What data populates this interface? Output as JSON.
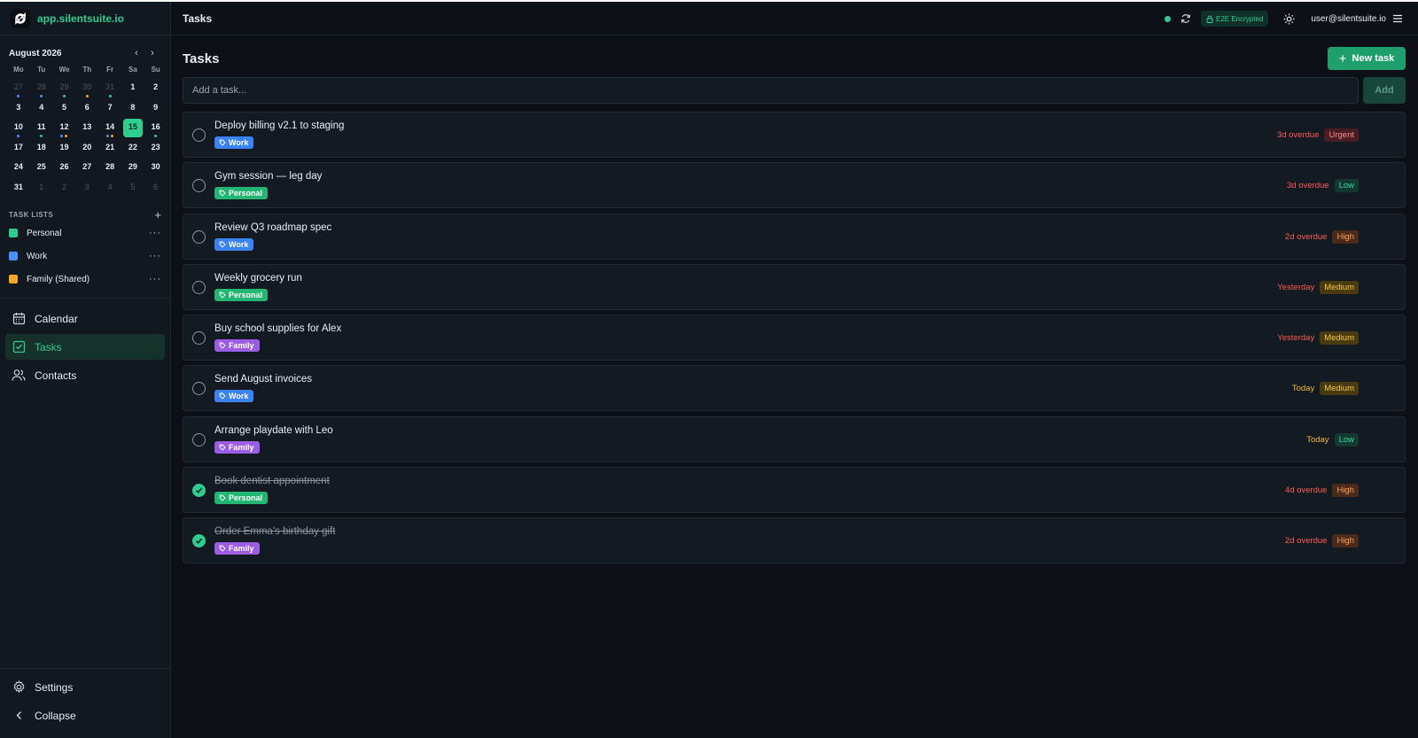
{
  "brand": {
    "name": "app.silentsuite.io"
  },
  "calendar": {
    "title": "August 2026",
    "weekdays": [
      "Mo",
      "Tu",
      "We",
      "Th",
      "Fr",
      "Sa",
      "Su"
    ],
    "days": [
      {
        "d": "27",
        "muted": true,
        "dots": [
          "#4c8dff"
        ]
      },
      {
        "d": "28",
        "muted": true,
        "dots": [
          "#4c8dff"
        ]
      },
      {
        "d": "29",
        "muted": true,
        "dots": [
          "#2ecc8f"
        ]
      },
      {
        "d": "30",
        "muted": true,
        "dots": [
          "#f5a623"
        ]
      },
      {
        "d": "31",
        "muted": true,
        "dots": [
          "#2ecc8f"
        ]
      },
      {
        "d": "1"
      },
      {
        "d": "2"
      },
      {
        "d": "3"
      },
      {
        "d": "4"
      },
      {
        "d": "5"
      },
      {
        "d": "6"
      },
      {
        "d": "7"
      },
      {
        "d": "8"
      },
      {
        "d": "9"
      },
      {
        "d": "10",
        "dots": [
          "#4c8dff"
        ]
      },
      {
        "d": "11",
        "dots": [
          "#2ecc8f"
        ]
      },
      {
        "d": "12",
        "dots": [
          "#4c8dff",
          "#f5a623"
        ]
      },
      {
        "d": "13"
      },
      {
        "d": "14",
        "dots": [
          "#4c8dff",
          "#f5a623"
        ]
      },
      {
        "d": "15",
        "today": true
      },
      {
        "d": "16",
        "dots": [
          "#2ecc8f"
        ]
      },
      {
        "d": "17"
      },
      {
        "d": "18"
      },
      {
        "d": "19"
      },
      {
        "d": "20"
      },
      {
        "d": "21"
      },
      {
        "d": "22"
      },
      {
        "d": "23"
      },
      {
        "d": "24"
      },
      {
        "d": "25"
      },
      {
        "d": "26"
      },
      {
        "d": "27"
      },
      {
        "d": "28"
      },
      {
        "d": "29"
      },
      {
        "d": "30"
      },
      {
        "d": "31"
      },
      {
        "d": "1",
        "muted": true
      },
      {
        "d": "2",
        "muted": true
      },
      {
        "d": "3",
        "muted": true
      },
      {
        "d": "4",
        "muted": true
      },
      {
        "d": "5",
        "muted": true
      },
      {
        "d": "6",
        "muted": true
      }
    ]
  },
  "task_lists": {
    "title": "TASK LISTS",
    "add_label": "+",
    "more_label": "···",
    "items": [
      {
        "label": "Personal",
        "color": "#2ecc8f"
      },
      {
        "label": "Work",
        "color": "#4c8dff"
      },
      {
        "label": "Family (Shared)",
        "color": "#f5a623"
      }
    ]
  },
  "nav": {
    "calendar": "Calendar",
    "tasks": "Tasks",
    "contacts": "Contacts",
    "settings": "Settings",
    "collapse": "Collapse"
  },
  "topbar": {
    "title": "Tasks",
    "encryption": "E2E Encrypted",
    "user": "user@silentsuite.io"
  },
  "main": {
    "title": "Tasks",
    "new_task": "New task",
    "new_task_icon": "+",
    "add_placeholder": "Add a task...",
    "add_button": "Add"
  },
  "colors": {
    "accent": "#2ecc8f",
    "tag_work": "#3b82f6",
    "tag_personal": "#22b573",
    "tag_family": "#9b5de5"
  },
  "tasks": [
    {
      "title": "Deploy billing v2.1 to staging",
      "tag": "Work",
      "due": "3d overdue",
      "priority": "Urgent",
      "done": false
    },
    {
      "title": "Gym session — leg day",
      "tag": "Personal",
      "due": "3d overdue",
      "priority": "Low",
      "done": false
    },
    {
      "title": "Review Q3 roadmap spec",
      "tag": "Work",
      "due": "2d overdue",
      "priority": "High",
      "done": false
    },
    {
      "title": "Weekly grocery run",
      "tag": "Personal",
      "due": "Yesterday",
      "priority": "Medium",
      "done": false
    },
    {
      "title": "Buy school supplies for Alex",
      "tag": "Family",
      "due": "Yesterday",
      "priority": "Medium",
      "done": false
    },
    {
      "title": "Send August invoices",
      "tag": "Work",
      "due": "Today",
      "priority": "Medium",
      "done": false
    },
    {
      "title": "Arrange playdate with Leo",
      "tag": "Family",
      "due": "Today",
      "priority": "Low",
      "done": false
    },
    {
      "title": "Book dentist appointment",
      "tag": "Personal",
      "due": "4d overdue",
      "priority": "High",
      "done": true
    },
    {
      "title": "Order Emma's birthday gift",
      "tag": "Family",
      "due": "2d overdue",
      "priority": "High",
      "done": true
    }
  ]
}
